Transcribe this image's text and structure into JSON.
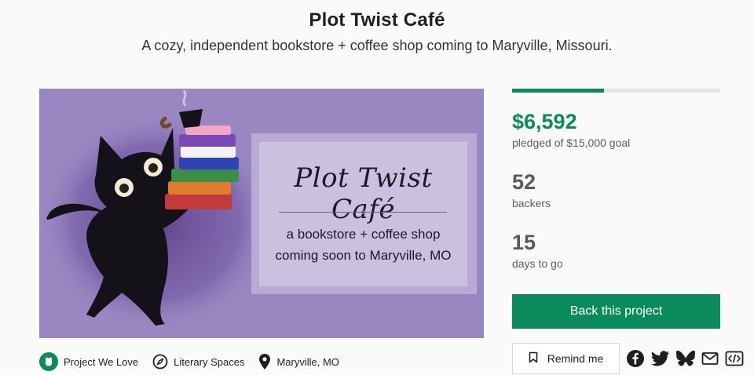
{
  "project": {
    "title": "Plot Twist Café",
    "blurb": "A cozy, independent bookstore + coffee shop coming to Maryville, Missouri."
  },
  "hero": {
    "title": "Plot Twist Café",
    "line1": "a bookstore + coffee shop",
    "line2": "coming soon to Maryville, MO"
  },
  "stats": {
    "progress_fraction": 0.44,
    "pledged": "$6,592",
    "pledged_label": "pledged of $15,000 goal",
    "backers": "52",
    "backers_label": "backers",
    "days": "15",
    "days_label": "days to go"
  },
  "actions": {
    "back_label": "Back this project",
    "remind_label": "Remind me"
  },
  "share": [
    "facebook-icon",
    "twitter-icon",
    "bluesky-icon",
    "mail-icon",
    "embed-icon"
  ],
  "tags": [
    {
      "icon": "project-we-love-badge-icon",
      "label": "Project We Love"
    },
    {
      "icon": "compass-icon",
      "label": "Literary Spaces"
    },
    {
      "icon": "location-pin-icon",
      "label": "Maryville, MO"
    }
  ],
  "colors": {
    "accent": "#0b8b5b",
    "hero_bg": "#9a86c1"
  }
}
